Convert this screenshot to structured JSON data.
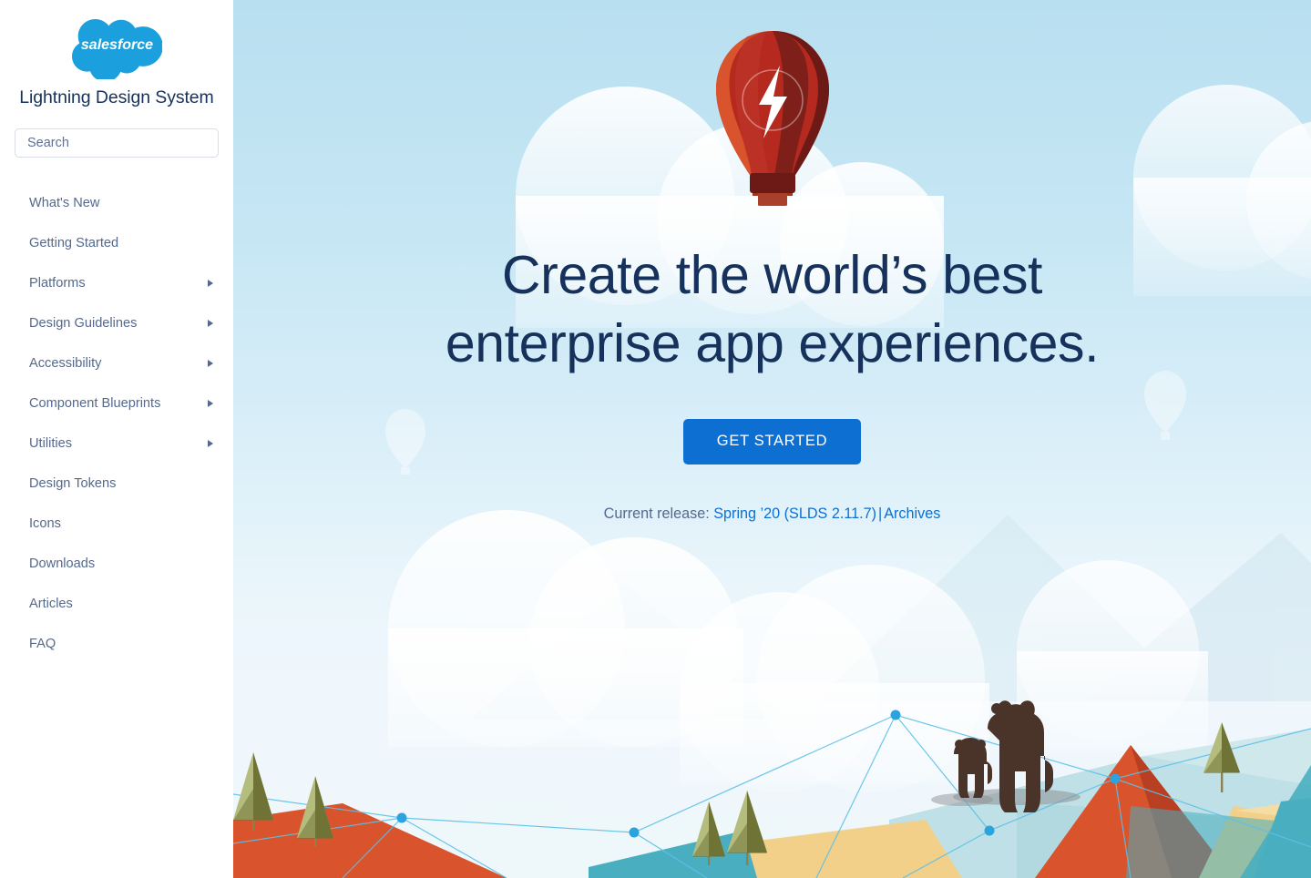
{
  "sidebar": {
    "logo": {
      "icon": "salesforce-cloud-logo",
      "wordmark": "salesforce"
    },
    "title": "Lightning Design System",
    "search": {
      "placeholder": "Search",
      "value": ""
    },
    "items": [
      {
        "label": "What's New",
        "expandable": false
      },
      {
        "label": "Getting Started",
        "expandable": false
      },
      {
        "label": "Platforms",
        "expandable": true
      },
      {
        "label": "Design Guidelines",
        "expandable": true
      },
      {
        "label": "Accessibility",
        "expandable": true
      },
      {
        "label": "Component Blueprints",
        "expandable": true
      },
      {
        "label": "Utilities",
        "expandable": true
      },
      {
        "label": "Design Tokens",
        "expandable": false
      },
      {
        "label": "Icons",
        "expandable": false
      },
      {
        "label": "Downloads",
        "expandable": false
      },
      {
        "label": "Articles",
        "expandable": false
      },
      {
        "label": "FAQ",
        "expandable": false
      }
    ]
  },
  "hero": {
    "illustration": "hot-air-balloon-lightning-bolt",
    "headline_line1": "Create the world’s best",
    "headline_line2": "enterprise app experiences.",
    "cta_label": "GET STARTED",
    "release": {
      "prefix": "Current release:",
      "version_link": "Spring ’20 (SLDS 2.11.7)",
      "separator": "|",
      "archives_link": "Archives"
    }
  },
  "colors": {
    "brand_blue": "#0d6fd1",
    "logo_cloud_blue": "#1ca0dd",
    "navy_text": "#16325c",
    "nav_text": "#54698d",
    "sky_top": "#b8dff0",
    "sky_bottom": "#eff7fb",
    "balloon_light": "#d9542c",
    "balloon_mid": "#b5291e",
    "balloon_dark": "#7a1f1a",
    "mountain_red": "#d9532c",
    "mountain_yellow": "#f2d08a",
    "mountain_teal": "#49afc0",
    "mountain_pale": "#bfe0e6",
    "tree_green": "#b5bd7e",
    "tree_green_dark": "#6f7436",
    "bear_brown": "#4a342a",
    "node_blue": "#2aa3de"
  }
}
